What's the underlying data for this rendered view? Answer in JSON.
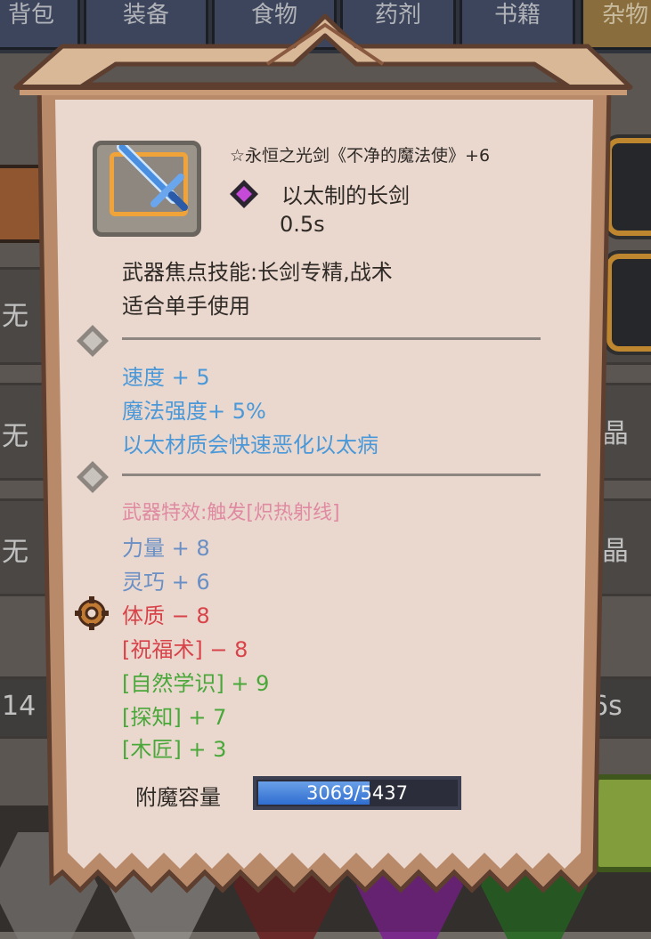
{
  "tabs": [
    {
      "label": "背包"
    },
    {
      "label": "装备"
    },
    {
      "label": "食物"
    },
    {
      "label": "药剂"
    },
    {
      "label": "书籍"
    },
    {
      "label": "杂物",
      "active": true
    }
  ],
  "background": {
    "row_texts": [
      "无",
      "无",
      "无"
    ],
    "right_texts": [
      "晶",
      "晶"
    ],
    "left_number": "14",
    "right_suffix": "6s"
  },
  "tooltip": {
    "item_name": "☆永恒之光剑《不净的魔法使》+6",
    "item_type": "以太制的长剑",
    "attack_speed": "0.5s",
    "focus_skill": "武器焦点技能:长剑专精,战术",
    "handedness": "适合单手使用",
    "enchant_stats": [
      "速度 + 5",
      "魔法强度+ 5%",
      "以太材质会快速恶化以太病"
    ],
    "weapon_effect": "武器特效:触发[炽热射线]",
    "attributes": [
      {
        "text": "力量 + 8",
        "tone": "positive"
      },
      {
        "text": "灵巧 + 6",
        "tone": "positive"
      }
    ],
    "negative_attributes": [
      "体质 − 8",
      "[祝福术] − 8"
    ],
    "skill_bonuses": [
      "[自然学识] + 9",
      "[探知] + 7",
      "[木匠] + 3"
    ],
    "enchant_capacity": {
      "label": "附魔容量",
      "text": "3069/5437",
      "current": 3069,
      "max": 5437
    }
  },
  "colors": {
    "parchment": "#ead8cf",
    "frame_brown": "#b88a6a",
    "rune_blue": "#4a98d8",
    "effect_pink": "#e08aa2",
    "negative_red": "#d8434a",
    "skill_green": "#4aa73a"
  },
  "icons": [
    "sword-icon",
    "gem-icon",
    "diamond-icon",
    "gear-icon"
  ]
}
